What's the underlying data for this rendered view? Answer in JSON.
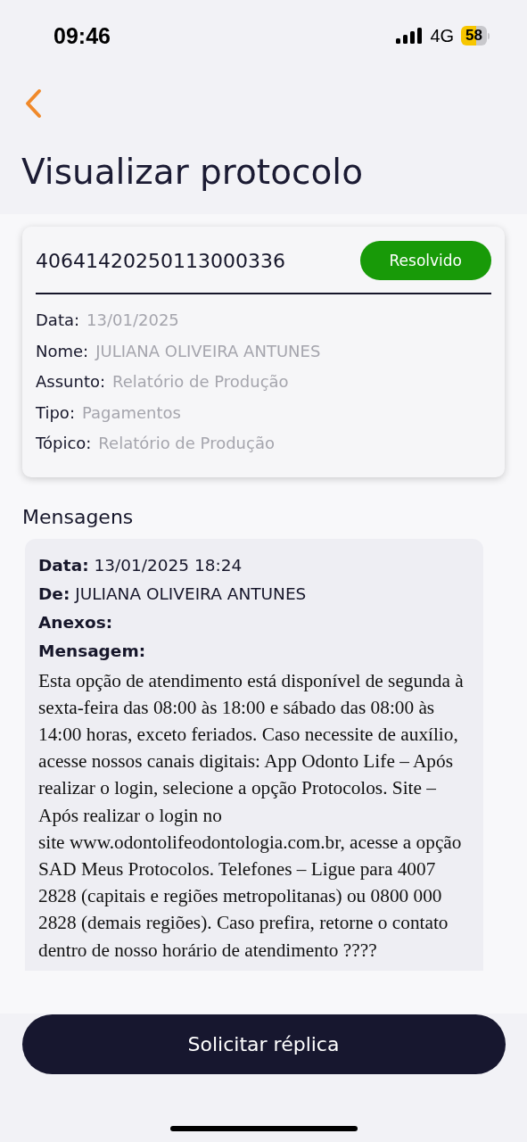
{
  "status_bar": {
    "time": "09:46",
    "network": "4G",
    "battery": "58"
  },
  "header": {
    "title": "Visualizar protocolo"
  },
  "protocol": {
    "number": "40641420250113000336",
    "status": {
      "label": "Resolvido",
      "kind": "resolved"
    },
    "fields": [
      {
        "label": "Data:",
        "value": "13/01/2025"
      },
      {
        "label": "Nome:",
        "value": "JULIANA OLIVEIRA ANTUNES"
      },
      {
        "label": "Assunto:",
        "value": "Relatório de Produção"
      },
      {
        "label": "Tipo:",
        "value": "Pagamentos"
      },
      {
        "label": "Tópico:",
        "value": "Relatório de Produção"
      }
    ]
  },
  "messages_title": "Mensagens",
  "messages": [
    {
      "meta": [
        "**Data:** 13/01/2025 18:24",
        "**De:** JULIANA OLIVEIRA ANTUNES",
        "**Anexos:**",
        "**Mensagem:**"
      ],
      "body": "Esta opção de atendimento está disponível de segunda à sexta-feira das 08:00 às 18:00 e sábado das 08:00 às 14:00 horas, exceto feriados. Caso necessite de auxílio, acesse nossos canais digitais: App Odonto Life – Após realizar o login, selecione a opção Protocolos. Site – Após realizar o login no\nsite www.odontolifeodontologia.com.br, acesse a opção SAD Meus Protocolos. Telefones – Ligue para 4007 2828 (capitais e regiões metropolitanas) ou 0800 000 2828 (demais regiões). Caso prefira, retorne o contato dentro de nosso horário de atendimento ????"
    }
  ],
  "action_button": "Solicitar réplica"
}
